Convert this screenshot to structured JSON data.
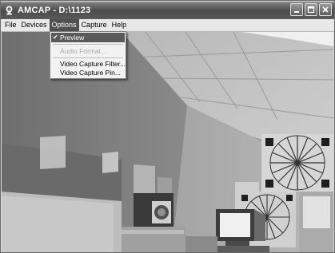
{
  "window": {
    "title": "AMCAP - D:\\1123",
    "title_icon": "webcam-icon",
    "controls": [
      "minimize-icon",
      "maximize-icon",
      "close-icon"
    ]
  },
  "menubar": {
    "items": [
      "File",
      "Devices",
      "Options",
      "Capture",
      "Help"
    ],
    "open_item": "Options"
  },
  "options_menu": {
    "items": [
      {
        "label": "Preview",
        "checked": true,
        "enabled": true
      },
      {
        "label": "Audio Format...",
        "checked": false,
        "enabled": false
      },
      {
        "label": "Video Capture Filter...",
        "checked": false,
        "enabled": true
      },
      {
        "label": "Video Capture Pin...",
        "checked": false,
        "enabled": true
      }
    ]
  },
  "preview": {
    "content": "webcam-preview-feed"
  }
}
